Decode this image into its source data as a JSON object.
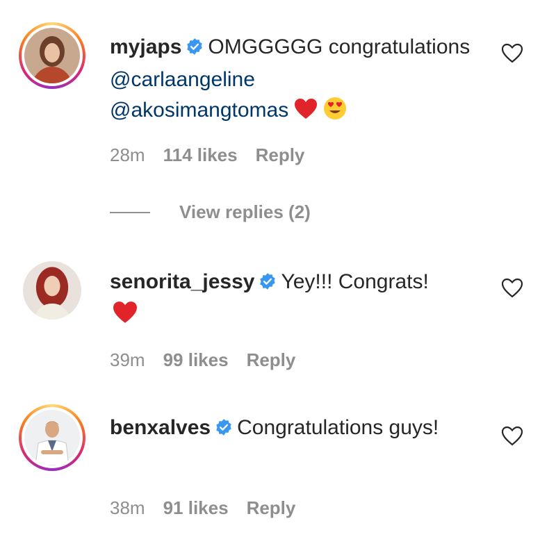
{
  "comments": [
    {
      "username": "myjaps",
      "text": "OMGGGGG congratulations",
      "mentions": [
        "@carlaangeline",
        "@akosimangtomas"
      ],
      "emojis": [
        "red-heart-emoji",
        "heart-eyes-emoji"
      ],
      "time": "28m",
      "likes": "114 likes",
      "reply": "Reply",
      "view_replies": "View replies (2)"
    },
    {
      "username": "senorita_jessy",
      "text": "Yey!!! Congrats!",
      "emojis": [
        "red-heart-emoji"
      ],
      "time": "39m",
      "likes": "99 likes",
      "reply": "Reply"
    },
    {
      "username": "benxalves",
      "text": "Congratulations guys!",
      "time": "38m",
      "likes": "91 likes",
      "reply": "Reply"
    }
  ],
  "colors": {
    "text": "#262626",
    "muted": "#8e8e8e",
    "mention": "#00376b",
    "verified": "#3897f0"
  }
}
